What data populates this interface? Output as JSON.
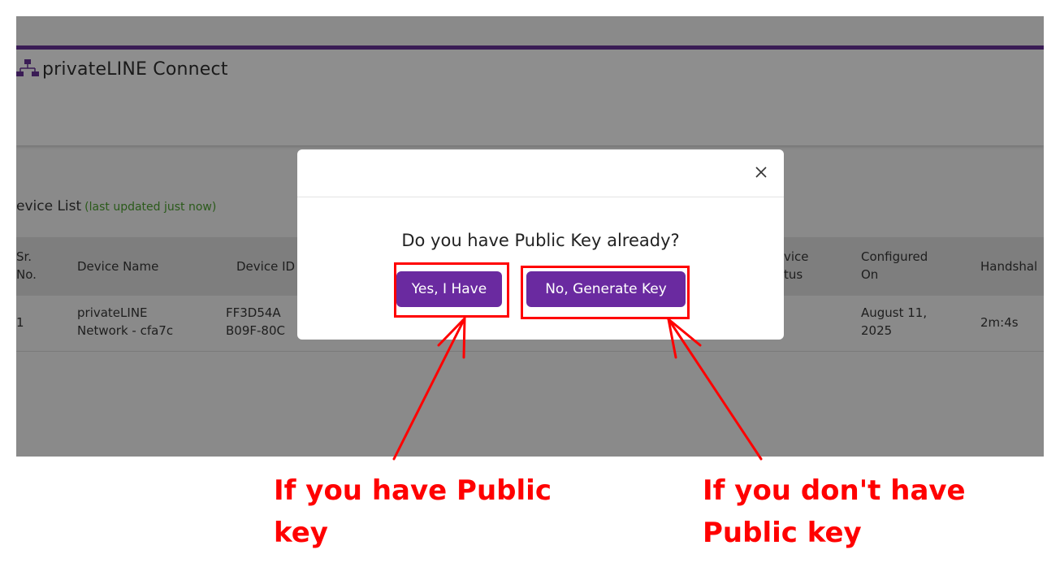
{
  "app": {
    "title": "privateLINE Connect"
  },
  "device_list": {
    "title": "evice List",
    "subtitle": "(last updated just now)",
    "columns": [
      "Sr.\nNo.",
      "Device Name",
      "Device ID",
      "vice\ntus",
      "Configured\nOn",
      "Handshal"
    ],
    "rows": [
      {
        "sr": "1",
        "name": "privateLINE\nNetwork - cfa7c",
        "id": "FF3D54A\nB09F-80C",
        "configured": "August 11,\n2025",
        "handshake": "2m:4s"
      }
    ]
  },
  "modal": {
    "question": "Do you have Public Key already?",
    "yes_label": "Yes, I Have",
    "no_label": "No, Generate Key"
  },
  "annotations": {
    "left": "If you have Public key",
    "right": "If you don't have Public key"
  },
  "colors": {
    "overlay": "#8a8a8a",
    "accent_line": "#3a1c55",
    "button": "#6a2aa0",
    "annotation": "#ff0000"
  }
}
